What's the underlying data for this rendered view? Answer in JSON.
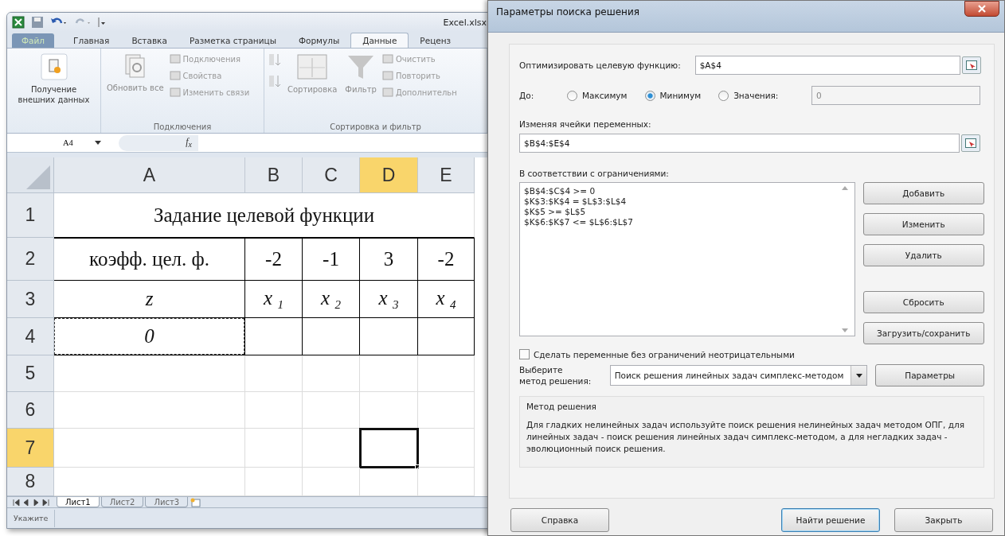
{
  "excel": {
    "file_name": "Excel.xlsx",
    "tabs": [
      {
        "label": "Файл",
        "kind": "file",
        "selected": false
      },
      {
        "label": "Главная",
        "kind": "tab",
        "selected": false
      },
      {
        "label": "Вставка",
        "kind": "tab",
        "selected": false
      },
      {
        "label": "Разметка страницы",
        "kind": "tab",
        "selected": false
      },
      {
        "label": "Формулы",
        "kind": "tab",
        "selected": false
      },
      {
        "label": "Данные",
        "kind": "tab",
        "selected": true
      },
      {
        "label": "Реценз",
        "kind": "tab",
        "selected": false
      }
    ],
    "ribbon_groups": [
      {
        "items": [
          {
            "kind": "large",
            "label": "Получение внешних данных",
            "disabled": false
          }
        ]
      },
      {
        "label": "Подключения",
        "items": [
          {
            "kind": "large",
            "label": "Обновить все",
            "disabled": true
          },
          {
            "kind": "stack",
            "children": [
              {
                "label": "Подключения",
                "disabled": true
              },
              {
                "label": "Свойства",
                "disabled": true
              },
              {
                "label": "Изменить связи",
                "disabled": true
              }
            ]
          }
        ]
      },
      {
        "label": "Сортировка и фильтр",
        "items": [
          {
            "kind": "sort_pair",
            "disabled": true
          },
          {
            "kind": "large",
            "label": "Сортировка",
            "disabled": true
          },
          {
            "kind": "large",
            "label": "Фильтр",
            "disabled": true
          },
          {
            "kind": "stack",
            "children": [
              {
                "label": "Очистить",
                "disabled": true
              },
              {
                "label": "Повторить",
                "disabled": true
              },
              {
                "label": "Дополнительн",
                "disabled": true
              }
            ]
          }
        ]
      }
    ],
    "name_box": "A4",
    "fx": "f$_{x}$",
    "columns": [
      {
        "label": "A",
        "selected": false
      },
      {
        "label": "B",
        "selected": false
      },
      {
        "label": "C",
        "selected": false
      },
      {
        "label": "D",
        "selected": true
      },
      {
        "label": "E",
        "selected": false
      }
    ],
    "rows": [
      {
        "number": "1",
        "selected": false,
        "table": false,
        "cells": [
          {
            "text": "Задание целевой функции"
          }
        ]
      },
      {
        "number": "2",
        "selected": false,
        "table": true,
        "cells": [
          {
            "text": "коэфф. цел. ф."
          },
          {
            "text": "-2"
          },
          {
            "text": "-1"
          },
          {
            "text": "3"
          },
          {
            "text": "-2"
          }
        ]
      },
      {
        "number": "3",
        "selected": false,
        "table": true,
        "cells": [
          {
            "text": "z",
            "italic": true
          },
          {
            "text": "x $_{1}$",
            "italic": true
          },
          {
            "text": "x $_{2}$",
            "italic": true
          },
          {
            "text": "x $_{3}$",
            "italic": true
          },
          {
            "text": "x $_{4}$",
            "italic": true
          }
        ]
      },
      {
        "number": "4",
        "selected": false,
        "table": true,
        "cells": [
          {
            "text": "0",
            "italic": true,
            "marquee": true
          },
          {},
          {},
          {},
          {}
        ]
      },
      {
        "number": "5",
        "selected": false,
        "table": false,
        "cells": [
          {},
          {},
          {},
          {},
          {}
        ]
      },
      {
        "number": "6",
        "selected": false,
        "table": false,
        "cells": [
          {},
          {},
          {},
          {},
          {}
        ]
      },
      {
        "number": "7",
        "selected": true,
        "table": false,
        "cells": [
          {},
          {},
          {},
          {
            "active": true
          },
          {}
        ]
      },
      {
        "number": "8",
        "selected": false,
        "table": false,
        "cells": [
          {},
          {},
          {},
          {},
          {}
        ]
      }
    ],
    "sheets": [
      {
        "label": "Лист1",
        "selected": true
      },
      {
        "label": "Лист2",
        "selected": false
      },
      {
        "label": "Лист3",
        "selected": false
      }
    ],
    "status": "Укажите"
  },
  "dialog": {
    "title": "Параметры поиска решения",
    "objective": {
      "label": "Оптимизировать целевую функцию:",
      "value": "$A$4"
    },
    "to": {
      "label": "До:",
      "options": [
        {
          "label": "Максимум",
          "selected": false
        },
        {
          "label": "Минимум",
          "selected": true
        },
        {
          "label": "Значения:",
          "selected": false
        }
      ],
      "value": "0",
      "value_disabled": true
    },
    "variables": {
      "label": "Изменяя ячейки переменных:",
      "value": "$B$4:$E$4"
    },
    "constraints": {
      "label": "В соответствии с ограничениями:",
      "items": [
        "$B$4:$C$4 >= 0",
        "$K$3:$K$4 = $L$3:$L$4",
        "$K$5 >= $L$5",
        "$K$6:$K$7 <= $L$6:$L$7"
      ]
    },
    "side_buttons": [
      "Добавить",
      "Изменить",
      "Удалить",
      "Сбросить",
      "Загрузить/сохранить"
    ],
    "nonnegative": {
      "label": "Сделать переменные без ограничений неотрицательными",
      "checked": false
    },
    "method": {
      "label_lines": [
        "Выберите",
        "метод решения:"
      ],
      "value": "Поиск решения линейных задач симплекс-методом",
      "button": "Параметры"
    },
    "method_info": {
      "title": "Метод решения",
      "text": "Для гладких нелинейных задач используйте поиск решения нелинейных задач методом ОПГ, для линейных задач - поиск решения линейных задач симплекс-методом, а для негладких задач - эволюционный поиск решения."
    },
    "footer_buttons": [
      {
        "label": "Справка",
        "default": false
      },
      {
        "label": "Найти решение",
        "default": true
      },
      {
        "label": "Закрыть",
        "default": false
      }
    ]
  }
}
